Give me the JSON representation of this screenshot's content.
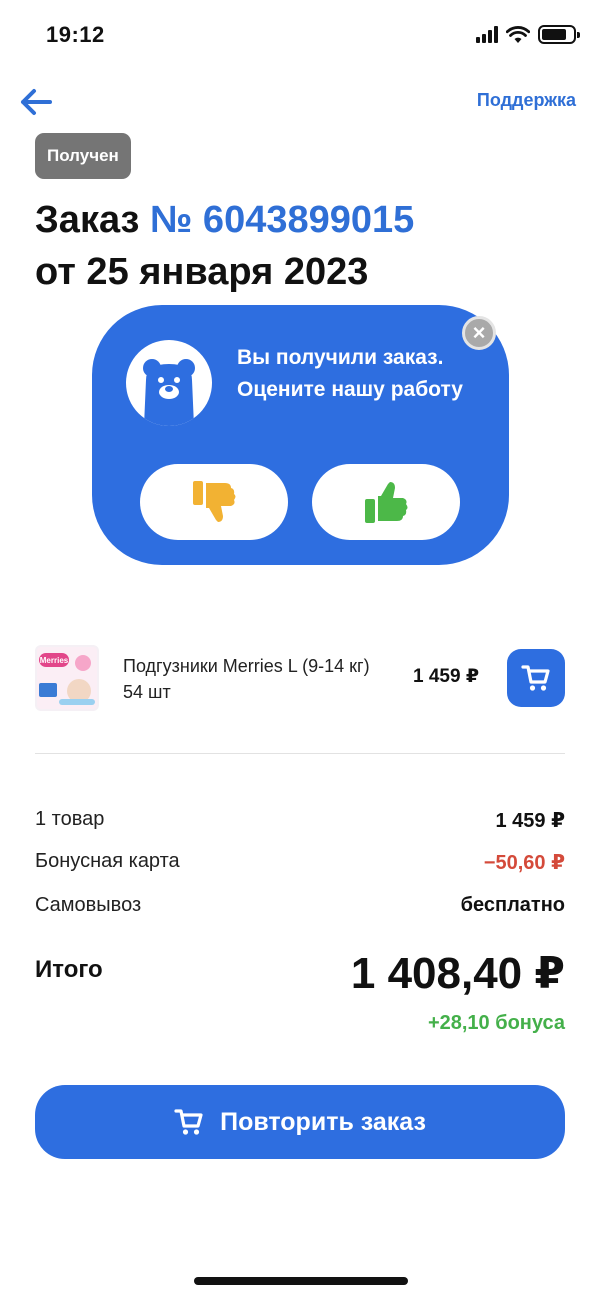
{
  "status_bar": {
    "time": "19:12"
  },
  "nav": {
    "back_icon": "arrow-left-icon",
    "support_label": "Поддержка"
  },
  "order": {
    "status": "Получен",
    "title_prefix": "Заказ",
    "number": "№ 6043899015",
    "date": "от 25 января 2023"
  },
  "rating": {
    "text": "Вы получили заказ. Оцените нашу работу",
    "dislike_icon": "thumbs-down-icon",
    "like_icon": "thumbs-up-icon",
    "close_icon": "close-icon"
  },
  "product": {
    "thumb_brand": "Merries",
    "name": "Подгузники Merries L (9-14 кг) 54 шт",
    "price": "1 459 ₽",
    "cart_icon": "cart-icon"
  },
  "summary": {
    "items_label": "1 товар",
    "items_value": "1 459 ₽",
    "bonus_label": "Бонусная карта",
    "bonus_value": "−50,60 ₽",
    "pickup_label": "Самовывоз",
    "pickup_value": "бесплатно",
    "total_label": "Итого",
    "total_value": "1 408,40 ₽",
    "bonus_earned": "+28,10 бонуса"
  },
  "actions": {
    "repeat_label": "Повторить заказ"
  },
  "colors": {
    "accent": "#2e6ee0",
    "link": "#2f6fd6",
    "discount": "#d44a3a",
    "bonus": "#44b04a",
    "badge": "#757575",
    "dislike": "#f2b233",
    "like": "#4cb848"
  }
}
